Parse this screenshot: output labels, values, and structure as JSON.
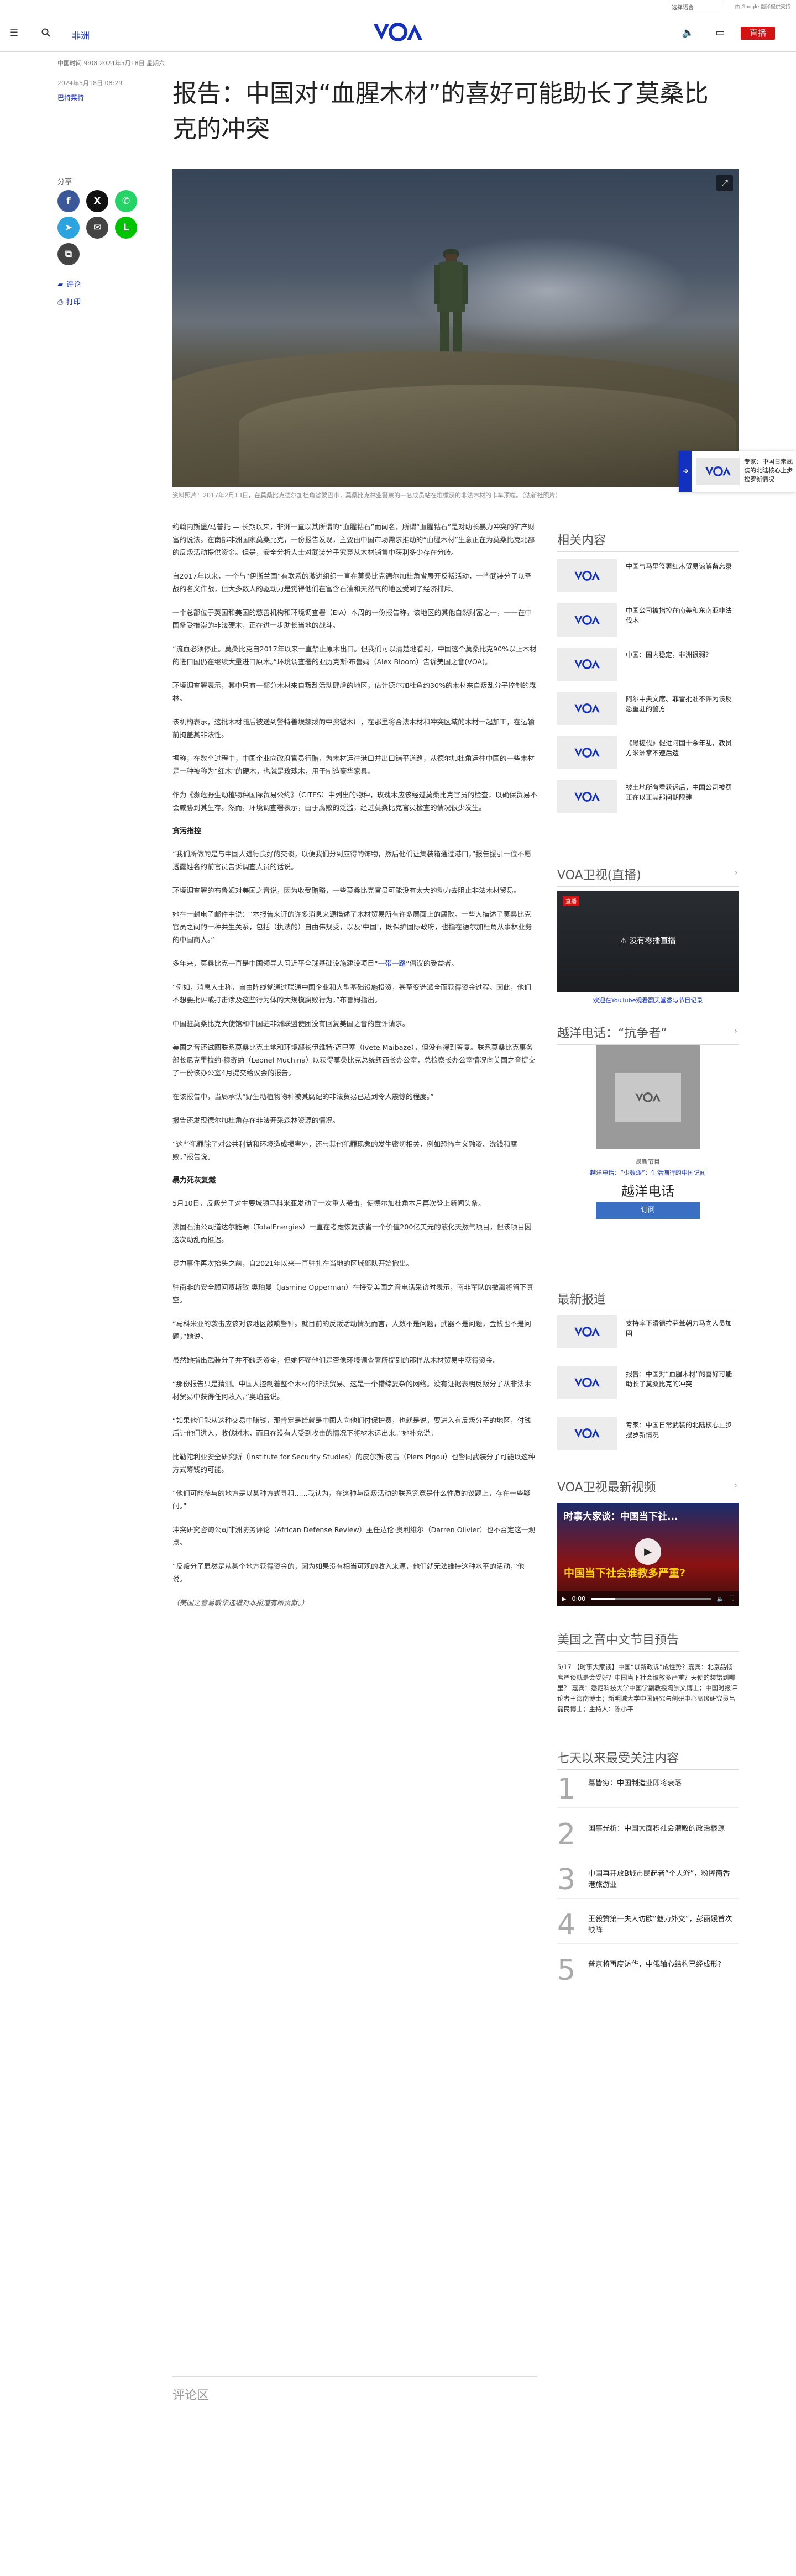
{
  "topbar": {
    "language_select": "选择语言",
    "powered_by": "由 Google 翻译提供支持"
  },
  "header": {
    "region": "非洲",
    "live_label": "直播",
    "logo_text": "VOA"
  },
  "article": {
    "meta_line": "中国时间 9:08 2024年5月18日 星期六",
    "dateline": "2024年5月18日 08:29",
    "byline": "巴特菜特",
    "headline": "报告：中国对“血腥木材”的喜好可能助长了莫桑比克的冲突",
    "image_caption": "资料照片：2017年2月13日，在莫桑比克德尔加杜角省蒙巴市，莫桑比克林业警察的一名成员站在堆缴获的非法木材的卡车顶端。（法新社照片）",
    "share_label": "分享",
    "comments_link": "评论",
    "print_link": "打印",
    "comments_section": "评论区"
  },
  "share_buttons": [
    {
      "name": "facebook",
      "glyph": "f",
      "color": "#3b5998"
    },
    {
      "name": "x",
      "glyph": "X",
      "color": "#111111"
    },
    {
      "name": "whatsapp",
      "glyph": "✆",
      "color": "#25d366"
    },
    {
      "name": "telegram",
      "glyph": "➤",
      "color": "#2aa3de"
    },
    {
      "name": "email",
      "glyph": "✉",
      "color": "#444444"
    },
    {
      "name": "line",
      "glyph": "L",
      "color": "#00c300"
    },
    {
      "name": "copy",
      "glyph": "⧉",
      "color": "#444444"
    }
  ],
  "body": {
    "p1": "约翰内斯堡/马普托 — 长期以来，非洲一直以其所谓的“血腥钻石”而闻名，所谓“血腥钻石”是对助长暴力冲突的矿产财富的说法。在南部非洲国家莫桑比克，一份报告发现，主要由中国市场需求推动的“血腥木材”生意正在为莫桑比克北部的反叛活动提供资金。但是，安全分析人士对武装分子究竟从木材销售中获利多少存在分歧。",
    "p2": "自2017年以来，一个与“伊斯兰国”有联系的激进组织一直在莫桑比克德尔加杜角省展开反叛活动，一些武装分子以圣战的名义作战，但大多数人的驱动力是觉得他们在富含石油和天然气的地区受到了经济排斥。",
    "p3": "一个总部位于英国和美国的慈善机构和环境调查署（EIA）本周的一份报告称，该地区的其他自然财富之一，一一在中国备受推崇的非法硬木，正在进一步助长当地的战斗。",
    "p4": "“流血必须停止。莫桑比克自2017年以来一直禁止原木出口。但我们可以清楚地看到，中国这个莫桑比克90%以上木材的进口国仍在继续大量进口原木。”环境调查署的亚历克斯·布鲁姆（Alex Bloom）告诉美国之音(VOA)。",
    "p5": "环境调查署表示，其中只有一部分木材来自叛乱活动肆虐的地区，估计德尔加杜角约30%的木材来自叛乱分子控制的森林。",
    "p6": "该机构表示，这批木材随后被送到警特善埃兹拨的中资锯木厂，在那里将合法木材和冲突区域的木材一起加工，在运输前掩盖其非法性。",
    "p7": "据称，在数个过程中，中国企业向政府官员行贿，为木材运往港口并出口铺平道路，从德尔加杜角运往中国的一些木材是一种被称为“红木”的硬木，也就是玫瑰木，用于制造豪华家具。",
    "p8": "作为《濒危野生动植物种国际贸易公约》（CITES）中列出的物种，玫瑰木应该经过莫桑比克官员的检查，以确保贸易不会威胁到其生存。然而，环境调查署表示，由于腐败的泛滥，经过莫桑比克官员检查的情况很少发生。",
    "h1": "贪污指控",
    "p9": "“我们所做的是与中国人进行良好的交谈，以便我们分到应得的饰物，然后他们让集装箱通过港口，”报告援引一位不愿透露姓名的前官员告诉调查人员的话说。",
    "p10": "环境调查署的布鲁姆对美国之音说，因为收受贿赂，一些莫桑比克官员可能没有太大的动力去阻止非法木材贸易。",
    "p11": "她在一封电子邮件中说：“本报告来证的许多消息来源描述了木材贸易所有许多层面上的腐败。一些人描述了莫桑比克官员之间的一种共生关系，包括（执法的）自由伟规受，以及‘中国’，既保护国际政府，也指在德尔加杜角从事林业务的中国商人。”",
    "p12": "多年来，莫桑比克一直是中国领导人习近平全球基础设施建设项目“一带一路”倡议的受益者。",
    "p13": "“例如，消息人士称，自由阵线党通过联通中国企业和大型基础设施投资，甚至变选派全而获得资金过程。因此，他们不想要批评或打击涉及这些行为体的大规模腐败行为，”布鲁姆指出。",
    "p14": "中国驻莫桑比克大使馆和中国驻非洲联盟使团没有回复美国之音的置评请求。",
    "p15": "美国之音还试图联系莫桑比克土地和环境部长伊维特·迈巴塞（Ivete Maibaze），但没有得到答复。联系莫桑比克事务部长尼克里拉约·穆奇纳（Leonel Muchina）以获得莫桑比克总统纽西长办公室，总检察长办公室情况向美国之音提交了一份该办公室4月提交给议会的报告。",
    "p16": "在该报告中，当局承认“野生动植物物种被其腐纪的非法贸易已达到令人震惊的程度。”",
    "p17": "报告还发现德尔加杜角存在非法开采森林资源的情况。",
    "p18": "“这些犯罪除了对公共利益和环境造成损害外，还与其他犯罪现象的发生密切相关，例如恐怖主义融资、洗钱和腐败，”报告说。",
    "h2": "暴力死灰复燃",
    "p19": "5月10日，反叛分子对主要城镇马科米亚发动了一次重大袭击，使德尔加杜角本月再次登上新闻头条。",
    "p20": "法国石油公司道达尔能源（TotalEnergies）一直在考虑恢复该省一个价值200亿美元的液化天然气项目，但该项目因这次动乱而推迟。",
    "p21": "暴力事件再次抬头之前，自2021年以来一直驻扎在当地的区域部队开始撤出。",
    "p22": "驻南非的安全顾问贾斯敏·奥珀曼（Jasmine Opperman）在接受美国之音电话采访时表示，南非军队的撤离将留下真空。",
    "p23": "“马科米亚的袭击应该对该地区敲响警钟。就目前的反叛活动情况而言，人数不是问题，武器不是问题，金钱也不是问题，”她说。",
    "p24": "虽然她指出武装分子并不缺乏资金，但她怀疑他们是否像环境调查署所提到的那样从木材贸易中获得资金。",
    "p25": "“那份报告只是猜测。中国人控制着整个木材的非法贸易。这是一个错综复杂的网络。没有证据表明反叛分子从非法木材贸易中获得任何收入，”奥珀曼说。",
    "p26": "“如果他们能从这种交易中赚钱，那肯定是给就是中国人向他们付保护费，也就是说，要进入有反叛分子的地区，付钱后让他们进入，收伐树木，而且在没有人受到攻击的情况下将树木运出来。”她补充说。",
    "p27": "比勒陀利亚安全研究所（Institute for Security Studies）的皮尔斯·皮古（Piers Pigou）也警同武装分子可能以这种方式筹钱的可能。",
    "p28": "“他们可能参与的地方是以某种方式寻租......我认为，在这种与反叛活动的联系究竟是什么性质的议题上，存在一些疑问。”",
    "p29": "冲突研究咨询公司非洲防务评论（African Defense Review）主任达伦·奥利维尔（Darren Olivier）也不否定这一观点。",
    "p30": "“反叛分子显然是从某个地方获得资金的，因为如果没有相当可观的收入来源，他们就无法维持这种水平的活动，”他说。",
    "editor_note": "（美国之音葛敏华选编对本报道有所贡献。）",
    "belt_road_link": "一带一路"
  },
  "sidebar": {
    "related_heading": "相关内容",
    "related": [
      "中国与马里签署红木贸易谅解备忘录",
      "中国公司被指控在南美和东南亚非法伐木",
      "中国：国内稳定，非洲很弱？",
      "阿尔中央文席、菲雷批准不许为该反恐重驻的警方",
      "《黑搓伐》促进阿国十余年乱，教员方米洲掌不遵后遗",
      "被土地所有看获诉后，中国公司被罚正在以正其那间期限建"
    ],
    "tv_heading": "VOA卫视(直播)",
    "tv_message": "没有零播直播",
    "tv_sub": "欢迎在YouTube观看翻天堂香与节目记录",
    "call_heading": "越洋电话：“抗争者”",
    "call_latest": "最新节目",
    "call_ep": "越洋电话：“少数派”：生活潮行的中国记闻",
    "call_title": "越洋电话",
    "call_subscribe": "订阅",
    "latest_heading": "最新报道",
    "latest": [
      "支持率下滑德拉芬耸朝力马向人员加固",
      "报告：中国对“血腥木材”的喜好可能助长了莫桑比克的冲突",
      "专家：中国日常武装的北陆核心止步搜罗新情况"
    ],
    "video_heading": "VOA卫视最新视频",
    "video_title": "时事大家谈：中国当下社...",
    "video_banner": "中国当下社会谁教多严重?",
    "video_time": "0:00",
    "program_heading": "美国之音中文节目预告",
    "program_text": "5/17 【时事大家谈】中国“以新政诉”成性势？嘉宾：北京品畅席严谈就是会受好？中国当下社会谁教多严重？天使的装错到哪里？  嘉宾：悉尼科技大学中国学副教授冯崇义博士；中国时报评论者王海南博士；新明城大学中国研究与创研中心高级研究员吕磊民博士；主持人：陈小平",
    "top_heading": "七天以来最受关注内容",
    "top": [
      "葛皆穷：中国制造业即将衰落",
      "国事光析：中国大面积社会潜败的政治根源",
      "中国再开放B城市民起者“个人游”，粉挥南香港旅游业",
      "王毅赞第一夫人访欧“魅力外交”，彭丽媛首次缺阵",
      "普京将再度访华，中俄轴心结构已经成形？"
    ]
  }
}
